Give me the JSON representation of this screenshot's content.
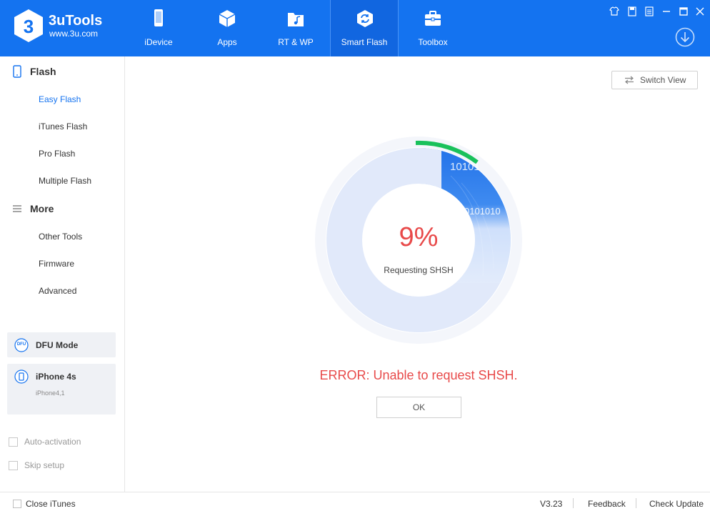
{
  "brand": {
    "name": "3uTools",
    "url": "www.3u.com"
  },
  "nav": {
    "items": [
      {
        "label": "iDevice",
        "icon": "phone-icon"
      },
      {
        "label": "Apps",
        "icon": "cube-icon"
      },
      {
        "label": "RT & WP",
        "icon": "music-folder-icon"
      },
      {
        "label": "Smart Flash",
        "icon": "flash-sync-icon",
        "active": true
      },
      {
        "label": "Toolbox",
        "icon": "toolbox-icon"
      }
    ]
  },
  "sidebar": {
    "flash_header": "Flash",
    "flash_items": [
      "Easy Flash",
      "iTunes Flash",
      "Pro Flash",
      "Multiple Flash"
    ],
    "more_header": "More",
    "more_items": [
      "Other Tools",
      "Firmware",
      "Advanced"
    ],
    "dfu": {
      "title": "DFU Mode",
      "badge": "DFU"
    },
    "device": {
      "title": "iPhone 4s",
      "model": "iPhone4,1"
    },
    "options": [
      "Auto-activation",
      "Skip setup"
    ]
  },
  "main": {
    "switch_view": "Switch View",
    "progress": {
      "percent_text": "9%",
      "percent": 9,
      "status": "Requesting SHSH",
      "binary_a": "10101",
      "binary_b": "0101010"
    },
    "error": "ERROR: Unable to request SHSH.",
    "ok": "OK"
  },
  "footer": {
    "close_itunes": "Close iTunes",
    "version": "V3.23",
    "feedback": "Feedback",
    "check_update": "Check Update"
  },
  "colors": {
    "header_blue": "#1473f0",
    "accent_green": "#19c15b",
    "error_red": "#e84a4a"
  }
}
